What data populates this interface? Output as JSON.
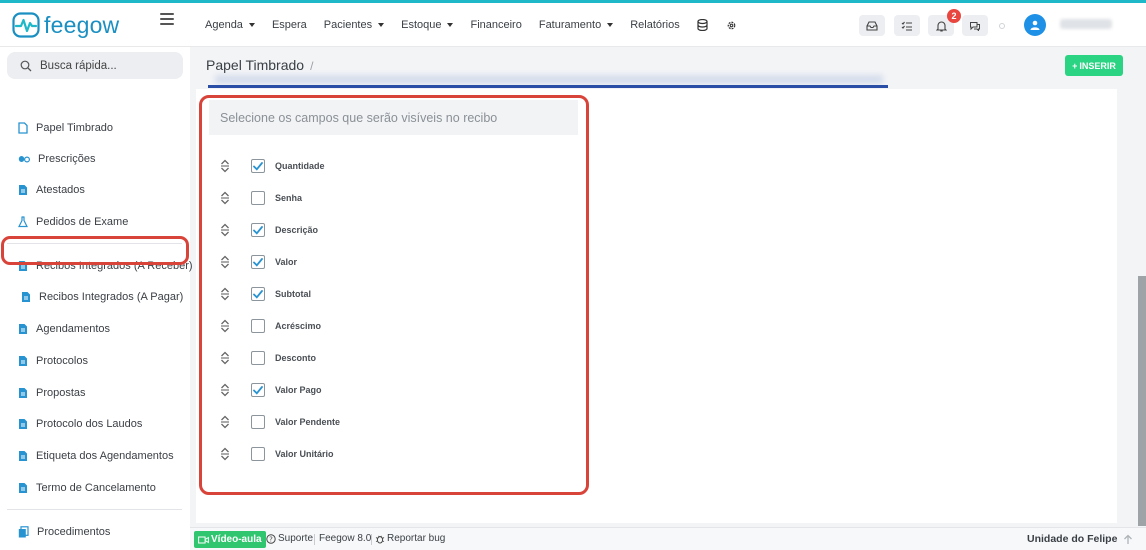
{
  "app": {
    "brand": "feegow",
    "colors": {
      "brand": "#1a8fc2",
      "accent_bar": "#1fb8c9",
      "insert_button": "#2bd482",
      "highlight": "#d9443a",
      "notification_badge": "#e8463e",
      "video_button": "#2fc66f"
    }
  },
  "topnav": {
    "items": [
      {
        "label": "Agenda",
        "dropdown": true
      },
      {
        "label": "Espera",
        "dropdown": false
      },
      {
        "label": "Pacientes",
        "dropdown": true
      },
      {
        "label": "Estoque",
        "dropdown": true
      },
      {
        "label": "Financeiro",
        "dropdown": false
      },
      {
        "label": "Faturamento",
        "dropdown": true
      },
      {
        "label": "Relatórios",
        "dropdown": false
      }
    ],
    "extra_icons": [
      "database-icon",
      "gear-icon"
    ],
    "right_icons": [
      "inbox-icon",
      "tasks-icon",
      "bell-icon",
      "chat-icon"
    ],
    "notification_count": "2"
  },
  "sidebar": {
    "search_placeholder": "Busca rápida...",
    "items": [
      {
        "label": "Papel Timbrado",
        "icon": "document-icon"
      },
      {
        "label": "Prescrições",
        "icon": "pills-icon"
      },
      {
        "label": "Atestados",
        "icon": "document-icon"
      },
      {
        "label": "Pedidos de Exame",
        "icon": "flask-icon"
      },
      {
        "label": "Recibos Integrados (A Receber)",
        "icon": "document-icon"
      },
      {
        "label": "Recibos Integrados (A Pagar)",
        "icon": "document-icon",
        "active": true
      },
      {
        "label": "Agendamentos",
        "icon": "document-icon"
      },
      {
        "label": "Protocolos",
        "icon": "document-icon"
      },
      {
        "label": "Propostas",
        "icon": "document-icon"
      },
      {
        "label": "Protocolo dos Laudos",
        "icon": "document-icon"
      },
      {
        "label": "Etiqueta dos Agendamentos",
        "icon": "document-icon"
      },
      {
        "label": "Termo de Cancelamento",
        "icon": "document-icon"
      },
      {
        "label": "Procedimentos",
        "icon": "copy-icon"
      }
    ]
  },
  "page": {
    "title": "Papel Timbrado",
    "breadcrumb_separator": "/",
    "insert_label": "INSERIR",
    "fields_header": "Selecione os campos que serão visíveis no recibo",
    "fields": [
      {
        "label": "Quantidade",
        "checked": true
      },
      {
        "label": "Senha",
        "checked": false
      },
      {
        "label": "Descrição",
        "checked": true
      },
      {
        "label": "Valor",
        "checked": true
      },
      {
        "label": "Subtotal",
        "checked": true
      },
      {
        "label": "Acréscimo",
        "checked": false
      },
      {
        "label": "Desconto",
        "checked": false
      },
      {
        "label": "Valor Pago",
        "checked": true
      },
      {
        "label": "Valor Pendente",
        "checked": false
      },
      {
        "label": "Valor Unitário",
        "checked": false
      }
    ]
  },
  "footer": {
    "video_label": "Vídeo-aula",
    "support_label": "Suporte",
    "version_label": "Feegow 8.0",
    "bug_label": "Reportar bug",
    "unit_label": "Unidade do Felipe"
  }
}
